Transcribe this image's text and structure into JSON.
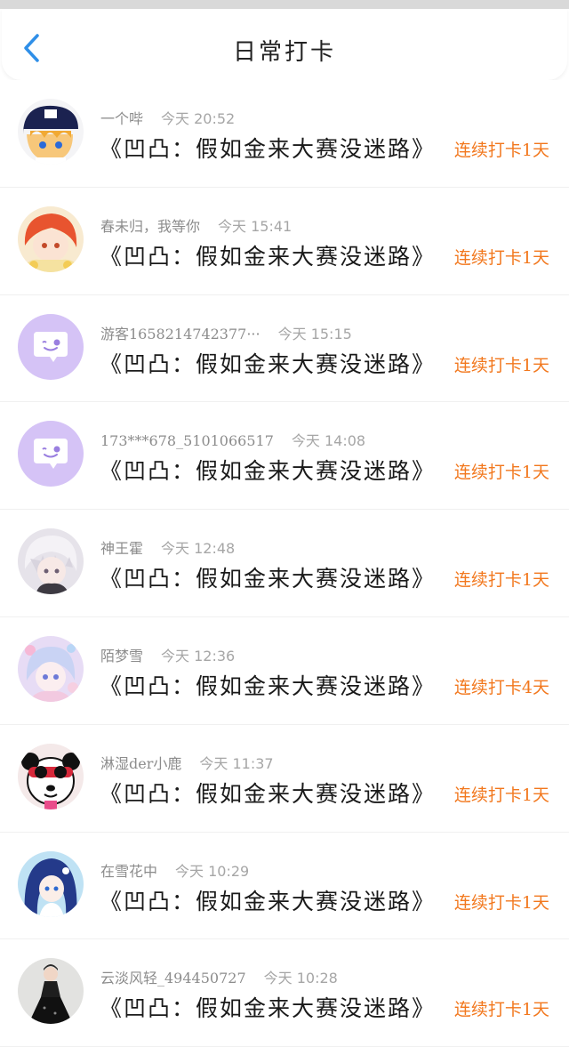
{
  "header": {
    "title": "日常打卡",
    "back_icon": "chevron-left-icon",
    "back_color": "#2f8fe8"
  },
  "colors": {
    "streak": "#f2781e",
    "guest_avatar_bg": "#d5c3f6"
  },
  "items": [
    {
      "username": "一个哔",
      "time": "今天 20:52",
      "title": "《凹凸：假如金来大赛没迷路》",
      "streak": "连续打卡1天",
      "avatar": "anime-boy-cap-avatar"
    },
    {
      "username": "春未归，我等你",
      "time": "今天 15:41",
      "title": "《凹凸：假如金来大赛没迷路》",
      "streak": "连续打卡1天",
      "avatar": "anime-girl-red-hair-avatar"
    },
    {
      "username": "游客1658214742377···",
      "time": "今天 15:15",
      "title": "《凹凸：假如金来大赛没迷路》",
      "streak": "连续打卡1天",
      "avatar": "guest-chat-bubble-avatar"
    },
    {
      "username": "173***678_5101066517",
      "time": "今天 14:08",
      "title": "《凹凸：假如金来大赛没迷路》",
      "streak": "连续打卡1天",
      "avatar": "guest-chat-bubble-avatar"
    },
    {
      "username": "神王霍",
      "time": "今天 12:48",
      "title": "《凹凸：假如金来大赛没迷路》",
      "streak": "连续打卡1天",
      "avatar": "anime-boy-white-hair-avatar"
    },
    {
      "username": "陌梦雪",
      "time": "今天 12:36",
      "title": "《凹凸：假如金来大赛没迷路》",
      "streak": "连续打卡4天",
      "avatar": "anime-girl-pastel-avatar"
    },
    {
      "username": "淋湿der小鹿",
      "time": "今天 11:37",
      "title": "《凹凸：假如金来大赛没迷路》",
      "streak": "连续打卡1天",
      "avatar": "panda-cartoon-avatar"
    },
    {
      "username": "在雪花中",
      "time": "今天 10:29",
      "title": "《凹凸：假如金来大赛没迷路》",
      "streak": "连续打卡1天",
      "avatar": "anime-girl-blue-hair-avatar"
    },
    {
      "username": "云淡风轻_494450727",
      "time": "今天 10:28",
      "title": "《凹凸：假如金来大赛没迷路》",
      "streak": "连续打卡1天",
      "avatar": "girl-black-dress-avatar"
    }
  ]
}
